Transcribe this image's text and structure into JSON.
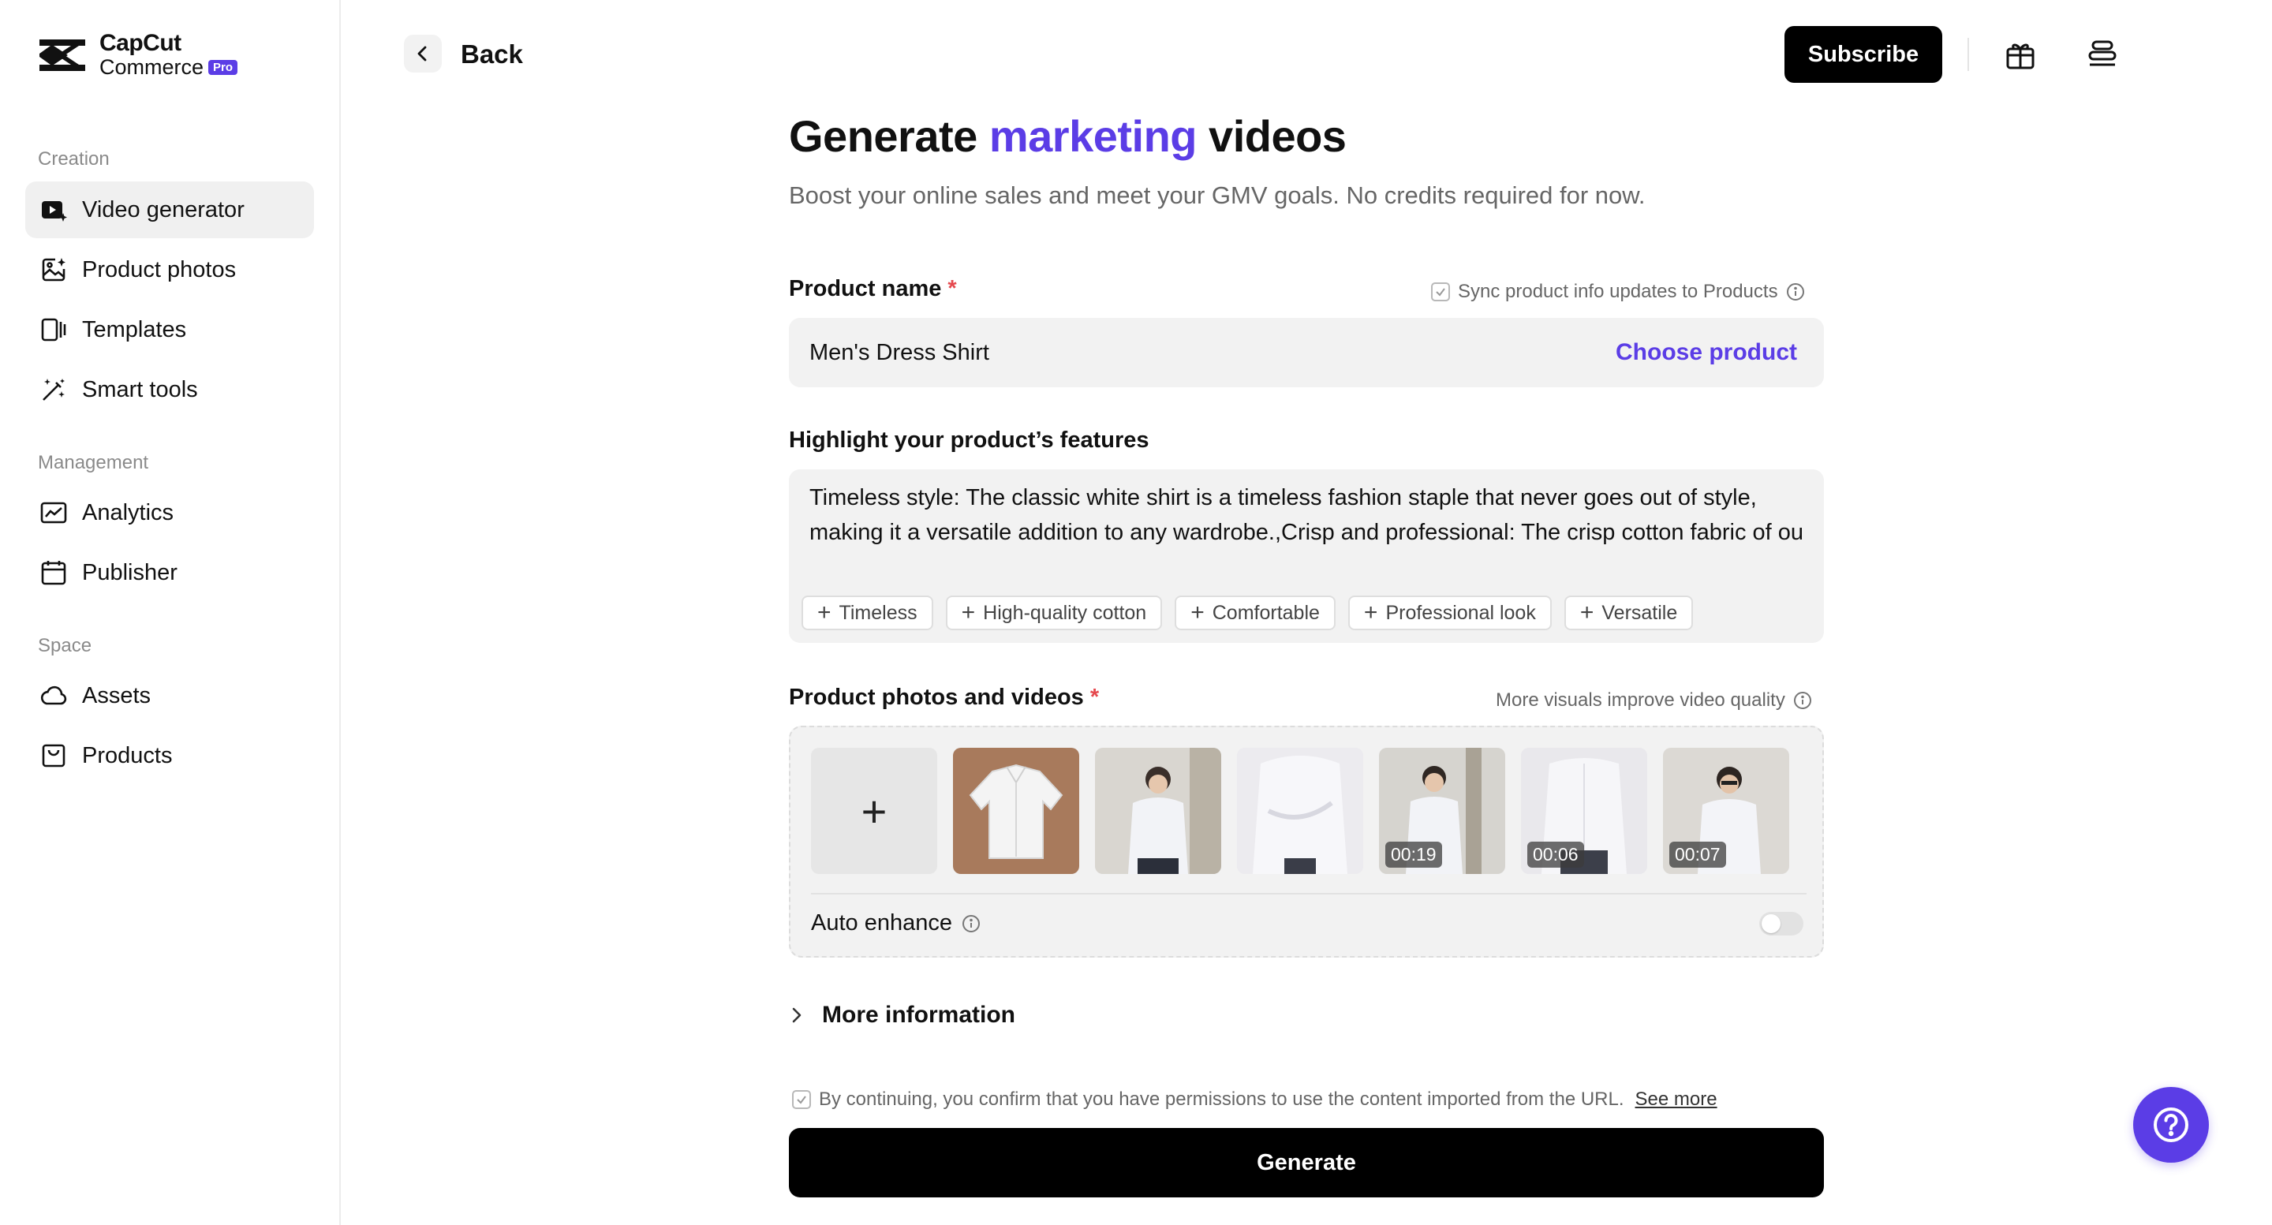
{
  "brand": {
    "line1": "CapCut",
    "line2": "Commerce",
    "badge": "Pro"
  },
  "sidebar": {
    "sections": [
      {
        "label": "Creation"
      },
      {
        "label": "Management"
      },
      {
        "label": "Space"
      }
    ],
    "items": [
      {
        "label": "Video generator",
        "icon": "video-generator-icon",
        "active": true
      },
      {
        "label": "Product photos",
        "icon": "product-photos-icon"
      },
      {
        "label": "Templates",
        "icon": "templates-icon"
      },
      {
        "label": "Smart tools",
        "icon": "magic-wand-icon"
      },
      {
        "label": "Analytics",
        "icon": "analytics-icon"
      },
      {
        "label": "Publisher",
        "icon": "calendar-icon"
      },
      {
        "label": "Assets",
        "icon": "cloud-icon"
      },
      {
        "label": "Products",
        "icon": "bag-icon"
      }
    ]
  },
  "header": {
    "back_label": "Back",
    "subscribe_label": "Subscribe"
  },
  "main": {
    "title_pre": "Generate ",
    "title_accent": "marketing",
    "title_post": " videos",
    "subtitle": "Boost your online sales and meet your GMV goals. No credits required for now.",
    "product_name": {
      "label": "Product name",
      "required_mark": "*",
      "sync_hint": "Sync product info updates to Products",
      "value": "Men's Dress Shirt",
      "choose_label": "Choose product"
    },
    "features": {
      "label": "Highlight your product’s features",
      "value": "Timeless style: The classic white shirt is a timeless fashion staple that never goes out of style, making it a versatile addition to any wardrobe.,Crisp and professional: The crisp cotton fabric of ou",
      "tags": [
        "Timeless",
        "High-quality cotton",
        "Comfortable",
        "Professional look",
        "Versatile"
      ]
    },
    "media": {
      "label": "Product photos and videos",
      "required_mark": "*",
      "hint": "More visuals improve video quality",
      "durations": [
        "00:19",
        "00:06",
        "00:07"
      ],
      "auto_enhance_label": "Auto enhance",
      "auto_enhance_on": false
    },
    "more_info_label": "More information",
    "consent_text": "By continuing, you confirm that you have permissions to use the content imported from the URL.",
    "see_more_label": "See more",
    "generate_label": "Generate"
  },
  "colors": {
    "accent": "#5b3de6",
    "required": "#e5484d"
  }
}
